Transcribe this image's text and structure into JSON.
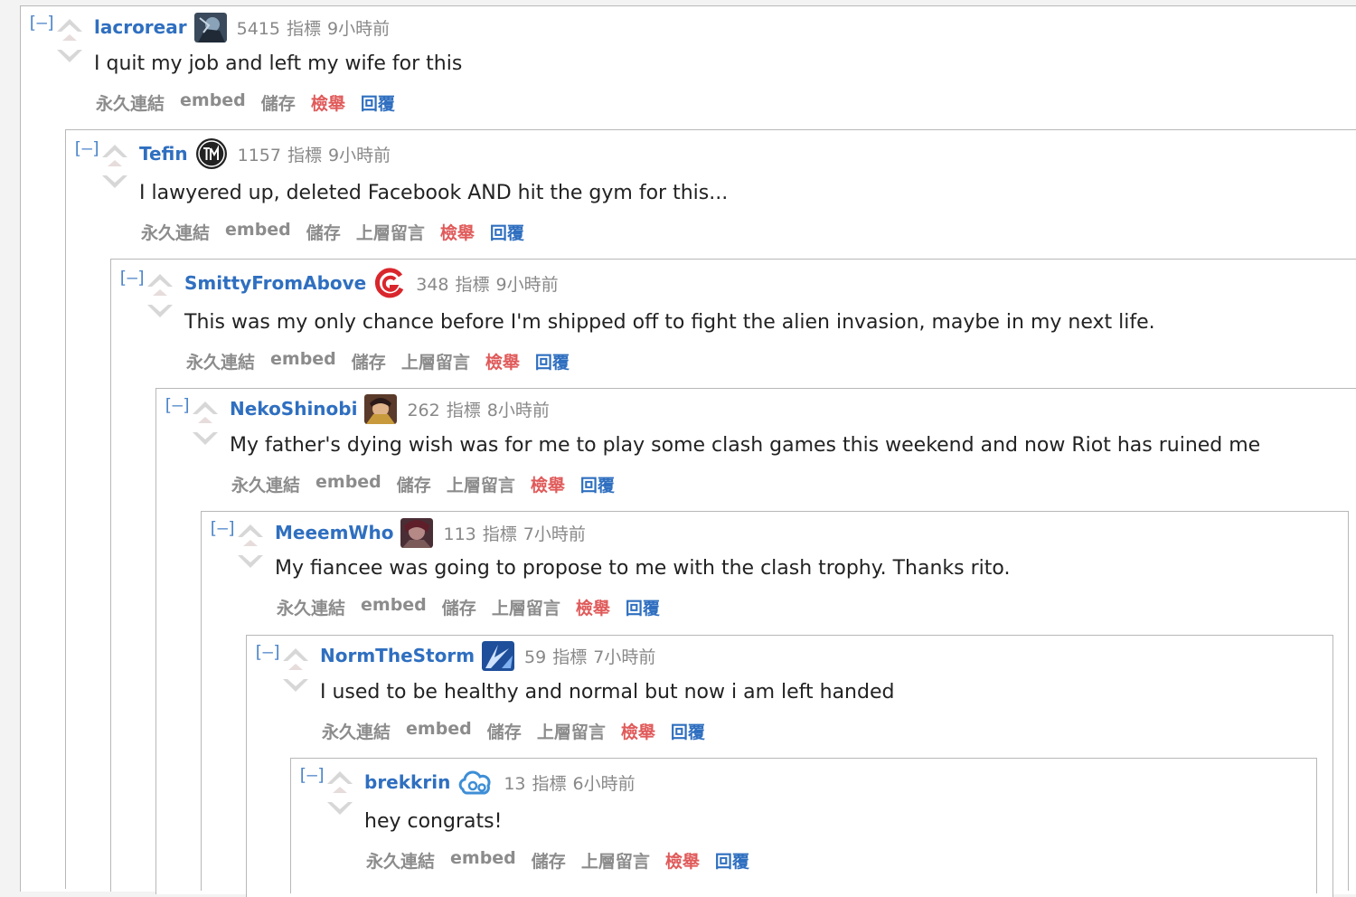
{
  "actions": {
    "permalink": "永久連結",
    "embed": "embed",
    "save": "儲存",
    "parent": "上層留言",
    "report": "檢舉",
    "reply": "回覆"
  },
  "collapse_label": "[–]",
  "points_label": "指標",
  "colors": {
    "author": "#2f6fc0",
    "report": "#e05a5a",
    "reply": "#2f6fc0",
    "meta": "#888888",
    "border": "#b8b8b8"
  },
  "comments": [
    {
      "author": "lacrorear",
      "flair_icon": "league-champion-avatar",
      "points": "5415",
      "time": "9小時前",
      "text": "I quit my job and left my wife for this",
      "has_parent": false
    },
    {
      "author": "Tefin",
      "flair_icon": "tsm-team-logo",
      "points": "1157",
      "time": "9小時前",
      "text": "I lawyered up, deleted Facebook AND hit the gym for this...",
      "has_parent": true
    },
    {
      "author": "SmittyFromAbove",
      "flair_icon": "counter-logic-gaming-logo",
      "points": "348",
      "time": "9小時前",
      "text": "This was my only chance before I'm shipped off to fight the alien invasion, maybe in my next life.",
      "has_parent": true
    },
    {
      "author": "NekoShinobi",
      "flair_icon": "league-champion-avatar",
      "points": "262",
      "time": "8小時前",
      "text": "My father's dying wish was for me to play some clash games this weekend and now Riot has ruined me",
      "has_parent": true
    },
    {
      "author": "MeeemWho",
      "flair_icon": "league-champion-avatar",
      "points": "113",
      "time": "7小時前",
      "text": "My fiancee was going to propose to me with the clash trophy. Thanks rito.",
      "has_parent": true
    },
    {
      "author": "NormTheStorm",
      "flair_icon": "league-champion-avatar",
      "points": "59",
      "time": "7小時前",
      "text": "I used to be healthy and normal but now i am left handed",
      "has_parent": true
    },
    {
      "author": "brekkrin",
      "flair_icon": "cloud9-logo",
      "points": "13",
      "time": "6小時前",
      "text": "hey congrats!",
      "has_parent": true
    }
  ]
}
